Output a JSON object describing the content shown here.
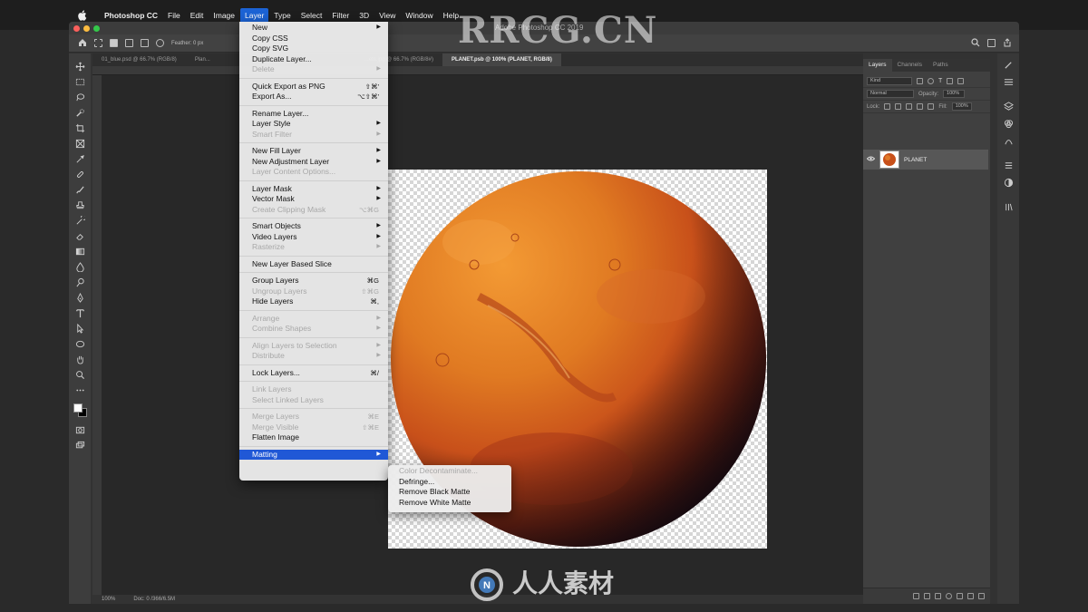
{
  "menubar": {
    "app": "Photoshop CC",
    "items": [
      "File",
      "Edit",
      "Image",
      "Layer",
      "Type",
      "Select",
      "Filter",
      "3D",
      "View",
      "Window",
      "Help"
    ],
    "active": "Layer"
  },
  "window": {
    "title": "Adobe Photoshop CC 2019",
    "options_label": "Feather: 0 px",
    "tabs": [
      "01_blue.psd @ 66.7% (RGB/8)",
      "Plan...",
      "...ets.jpg @ 66.7% (RGB/8#)",
      "PLANET.psb @ 100% (PLANET, RGB/8)"
    ],
    "active_tab_index": 3,
    "status": {
      "zoom": "100%",
      "doc": "Doc: 0 /366/6.5M"
    }
  },
  "layer_menu": {
    "groups": [
      [
        {
          "label": "New",
          "submenu": true
        },
        {
          "label": "Copy CSS"
        },
        {
          "label": "Copy SVG"
        },
        {
          "label": "Duplicate Layer..."
        },
        {
          "label": "Delete",
          "submenu": true,
          "disabled": true
        }
      ],
      [
        {
          "label": "Quick Export as PNG",
          "shortcut": "⇧⌘'"
        },
        {
          "label": "Export As...",
          "shortcut": "⌥⇧⌘'"
        }
      ],
      [
        {
          "label": "Rename Layer..."
        },
        {
          "label": "Layer Style",
          "submenu": true
        },
        {
          "label": "Smart Filter",
          "submenu": true,
          "disabled": true
        }
      ],
      [
        {
          "label": "New Fill Layer",
          "submenu": true
        },
        {
          "label": "New Adjustment Layer",
          "submenu": true
        },
        {
          "label": "Layer Content Options...",
          "disabled": true
        }
      ],
      [
        {
          "label": "Layer Mask",
          "submenu": true
        },
        {
          "label": "Vector Mask",
          "submenu": true
        },
        {
          "label": "Create Clipping Mask",
          "shortcut": "⌥⌘G",
          "disabled": true
        }
      ],
      [
        {
          "label": "Smart Objects",
          "submenu": true
        },
        {
          "label": "Video Layers",
          "submenu": true
        },
        {
          "label": "Rasterize",
          "submenu": true,
          "disabled": true
        }
      ],
      [
        {
          "label": "New Layer Based Slice"
        }
      ],
      [
        {
          "label": "Group Layers",
          "shortcut": "⌘G"
        },
        {
          "label": "Ungroup Layers",
          "shortcut": "⇧⌘G",
          "disabled": true
        },
        {
          "label": "Hide Layers",
          "shortcut": "⌘,"
        }
      ],
      [
        {
          "label": "Arrange",
          "submenu": true,
          "disabled": true
        },
        {
          "label": "Combine Shapes",
          "submenu": true,
          "disabled": true
        }
      ],
      [
        {
          "label": "Align Layers to Selection",
          "submenu": true,
          "disabled": true
        },
        {
          "label": "Distribute",
          "submenu": true,
          "disabled": true
        }
      ],
      [
        {
          "label": "Lock Layers...",
          "shortcut": "⌘/"
        }
      ],
      [
        {
          "label": "Link Layers",
          "disabled": true
        },
        {
          "label": "Select Linked Layers",
          "disabled": true
        }
      ],
      [
        {
          "label": "Merge Layers",
          "shortcut": "⌘E",
          "disabled": true
        },
        {
          "label": "Merge Visible",
          "shortcut": "⇧⌘E",
          "disabled": true
        },
        {
          "label": "Flatten Image"
        }
      ],
      [
        {
          "label": "Matting",
          "submenu": true,
          "highlighted": true
        }
      ]
    ]
  },
  "matting_submenu": [
    {
      "label": "Color Decontaminate...",
      "disabled": true
    },
    {
      "label": "Defringe..."
    },
    {
      "label": "Remove Black Matte"
    },
    {
      "label": "Remove White Matte"
    }
  ],
  "layers_panel": {
    "tabs": [
      "Layers",
      "Channels",
      "Paths"
    ],
    "filter_label": "Kind",
    "blend_mode": "Normal",
    "opacity_label": "Opacity:",
    "opacity": "100%",
    "lock_label": "Lock:",
    "fill_label": "Fill:",
    "fill": "100%",
    "layer_name": "PLANET"
  },
  "watermark": {
    "top": "RRCG.CN",
    "bottom": "人人素材"
  },
  "colors": {
    "menu_highlight": "#2058d6",
    "planet_light": "#e8862a",
    "planet_dark": "#2a1210"
  }
}
